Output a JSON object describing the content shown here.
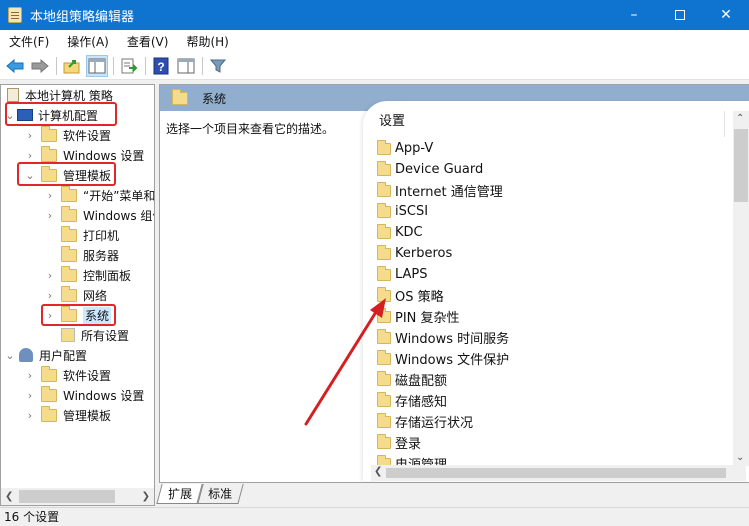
{
  "window": {
    "title": "本地组策略编辑器",
    "controls": [
      "minimize",
      "maximize",
      "close"
    ]
  },
  "menu": [
    "文件(F)",
    "操作(A)",
    "查看(V)",
    "帮助(H)"
  ],
  "toolbar": {
    "buttons": [
      "back-arrow-icon",
      "forward-arrow-icon",
      "up-folder-icon",
      "show-hide-tree-icon",
      "export-list-icon",
      "help-icon",
      "show-hide-action-pane-icon",
      "filter-icon"
    ]
  },
  "tree": {
    "root": "本地计算机 策略",
    "computer_config": "计算机配置",
    "computer_children": {
      "software": "软件设置",
      "windows": "Windows 设置",
      "admin_templates": "管理模板"
    },
    "admin_children": [
      "“开始”菜单和",
      "Windows 组件",
      "打印机",
      "服务器",
      "控制面板",
      "网络",
      "系统",
      "所有设置"
    ],
    "user_config": "用户配置",
    "user_children": [
      "软件设置",
      "Windows 设置",
      "管理模板"
    ]
  },
  "detail": {
    "header": "系统",
    "description": "选择一个项目来查看它的描述。",
    "column_header": "设置",
    "items": [
      "App-V",
      "Device Guard",
      "Internet 通信管理",
      "iSCSI",
      "KDC",
      "Kerberos",
      "LAPS",
      "OS 策略",
      "PIN 复杂性",
      "Windows 时间服务",
      "Windows 文件保护",
      "磁盘配额",
      "存储感知",
      "存储运行状况",
      "登录",
      "电源管理"
    ]
  },
  "tabs": [
    "扩展",
    "标准"
  ],
  "status": "16 个设置",
  "colors": {
    "titlebar": "#0f74d0",
    "header_band": "#92aece",
    "highlight_box": "#e02828",
    "annotation_arrow": "#d42020"
  }
}
